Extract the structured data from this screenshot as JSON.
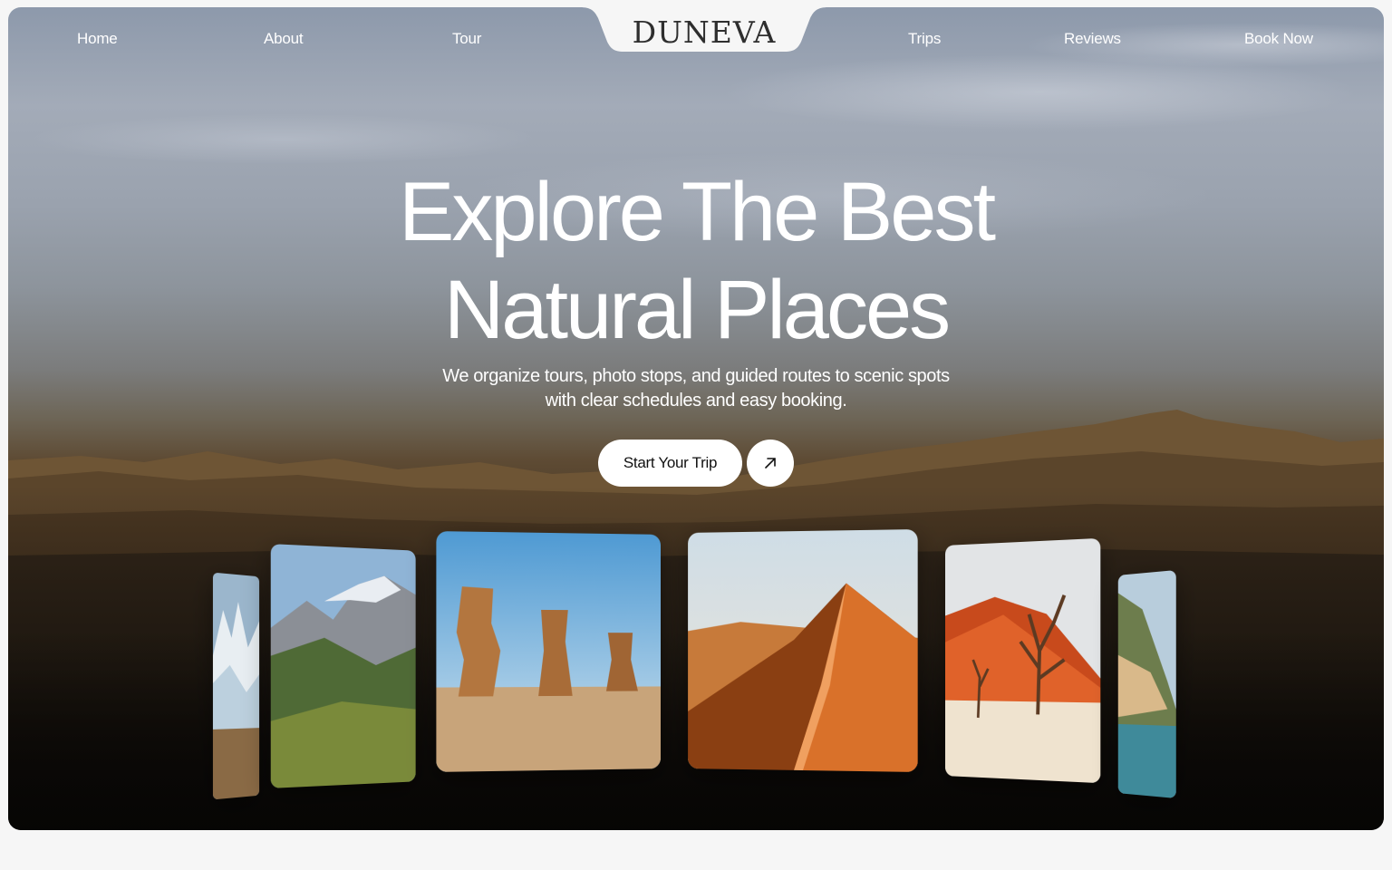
{
  "nav": {
    "left": [
      "Home",
      "About",
      "Tour"
    ],
    "right": [
      "Trips",
      "Reviews",
      "Book Now"
    ],
    "logo": "DUNEVA"
  },
  "hero": {
    "headline_line1": "Explore The Best",
    "headline_line2": "Natural Places",
    "subtitle_line1": "We organize tours, photo stops, and guided routes to scenic spots",
    "subtitle_line2": "with clear schedules and easy booking.",
    "cta_label": "Start Your Trip",
    "cta_icon": "arrow-up-right-icon"
  },
  "gallery": {
    "cards": [
      {
        "scene": "glacier-peaks"
      },
      {
        "scene": "alpine-valley"
      },
      {
        "scene": "rock-pillars"
      },
      {
        "scene": "sand-dune-ridge"
      },
      {
        "scene": "dead-trees-red-dune"
      },
      {
        "scene": "coastal-cliff"
      }
    ]
  },
  "colors": {
    "accent": "#ffffff",
    "page_background": "#f6f6f6",
    "logo_text": "#2e2e2e"
  }
}
